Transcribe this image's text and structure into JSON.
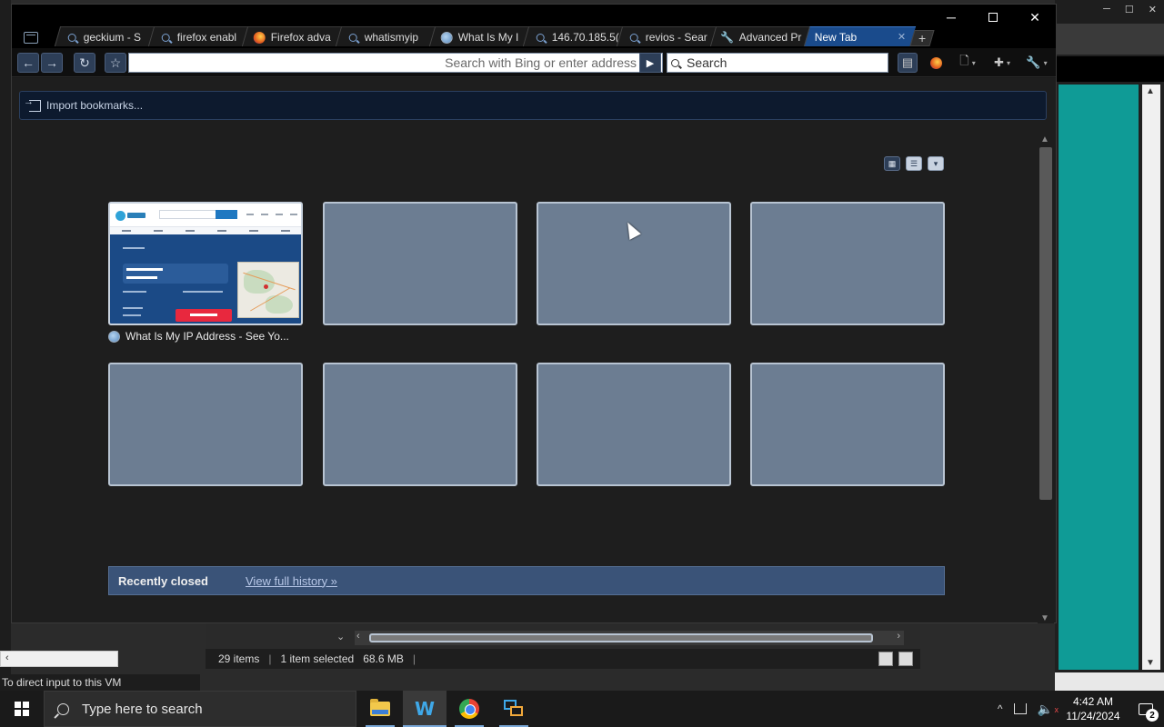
{
  "browser": {
    "window_controls": {
      "minimize": "─",
      "close": "✕"
    },
    "tabs": [
      {
        "label": "geckium - S",
        "icon": "search-icon"
      },
      {
        "label": "firefox enabl",
        "icon": "search-icon"
      },
      {
        "label": "Firefox adva",
        "icon": "firefox-icon"
      },
      {
        "label": "whatismyip",
        "icon": "search-icon"
      },
      {
        "label": "What Is My I",
        "icon": "globe-icon"
      },
      {
        "label": "146.70.185.5(",
        "icon": "search-icon"
      },
      {
        "label": "revios - Sear",
        "icon": "search-icon"
      },
      {
        "label": "Advanced Pr",
        "icon": "wrench-icon"
      },
      {
        "label": "New Tab",
        "icon": "",
        "active": true
      }
    ],
    "new_tab_plus": "+",
    "tab_close": "✕",
    "nav": {
      "back": "←",
      "forward": "→",
      "reload": "↻",
      "bookmark": "☆",
      "url_placeholder": "Search with Bing or enter address",
      "url_value": "",
      "go": "▶",
      "search_placeholder": "Search",
      "search_value": ""
    },
    "toolbar": {
      "page_menu_caret": "▾",
      "extensions_caret": "▾",
      "wrench_caret": "▾"
    },
    "import_bookmarks_label": "Import bookmarks...",
    "view_toggles": {
      "grid": "▦",
      "list": "☰",
      "dropdown": "▾"
    },
    "thumbnails": [
      {
        "title": "What Is My IP Address - See Yo...",
        "filled": true
      },
      {
        "title": "",
        "filled": false
      },
      {
        "title": "",
        "filled": false
      },
      {
        "title": "",
        "filled": false
      },
      {
        "title": "",
        "filled": false
      },
      {
        "title": "",
        "filled": false
      },
      {
        "title": "",
        "filled": false
      },
      {
        "title": "",
        "filled": false
      }
    ],
    "recently_closed": {
      "title": "Recently closed",
      "link": "View full history »"
    },
    "scroll": {
      "up": "▲",
      "down": "▼"
    }
  },
  "background": {
    "vm_hint": "To direct input to this VM",
    "explorer_status": {
      "items": "29 items",
      "selected": "1 item selected",
      "size": "68.6 MB",
      "sep": "|"
    },
    "scroll_arrows": {
      "left": "‹",
      "right": "›",
      "up": "▲",
      "down": "▼",
      "chevron": "⌄"
    },
    "window_controls": {
      "minimize": "─",
      "maximize": "☐",
      "close": "✕"
    }
  },
  "taskbar": {
    "search_placeholder": "Type here to search",
    "time": "4:42 AM",
    "date": "11/24/2024",
    "notification_count": "2",
    "tray_chevron": "^",
    "volume_glyph": "🔈",
    "mute_glyph": "x",
    "apps": [
      {
        "name": "file-explorer",
        "active": false
      },
      {
        "name": "windsurf",
        "active": true
      },
      {
        "name": "chrome",
        "active": false
      },
      {
        "name": "remote-desktop",
        "active": false
      }
    ]
  }
}
